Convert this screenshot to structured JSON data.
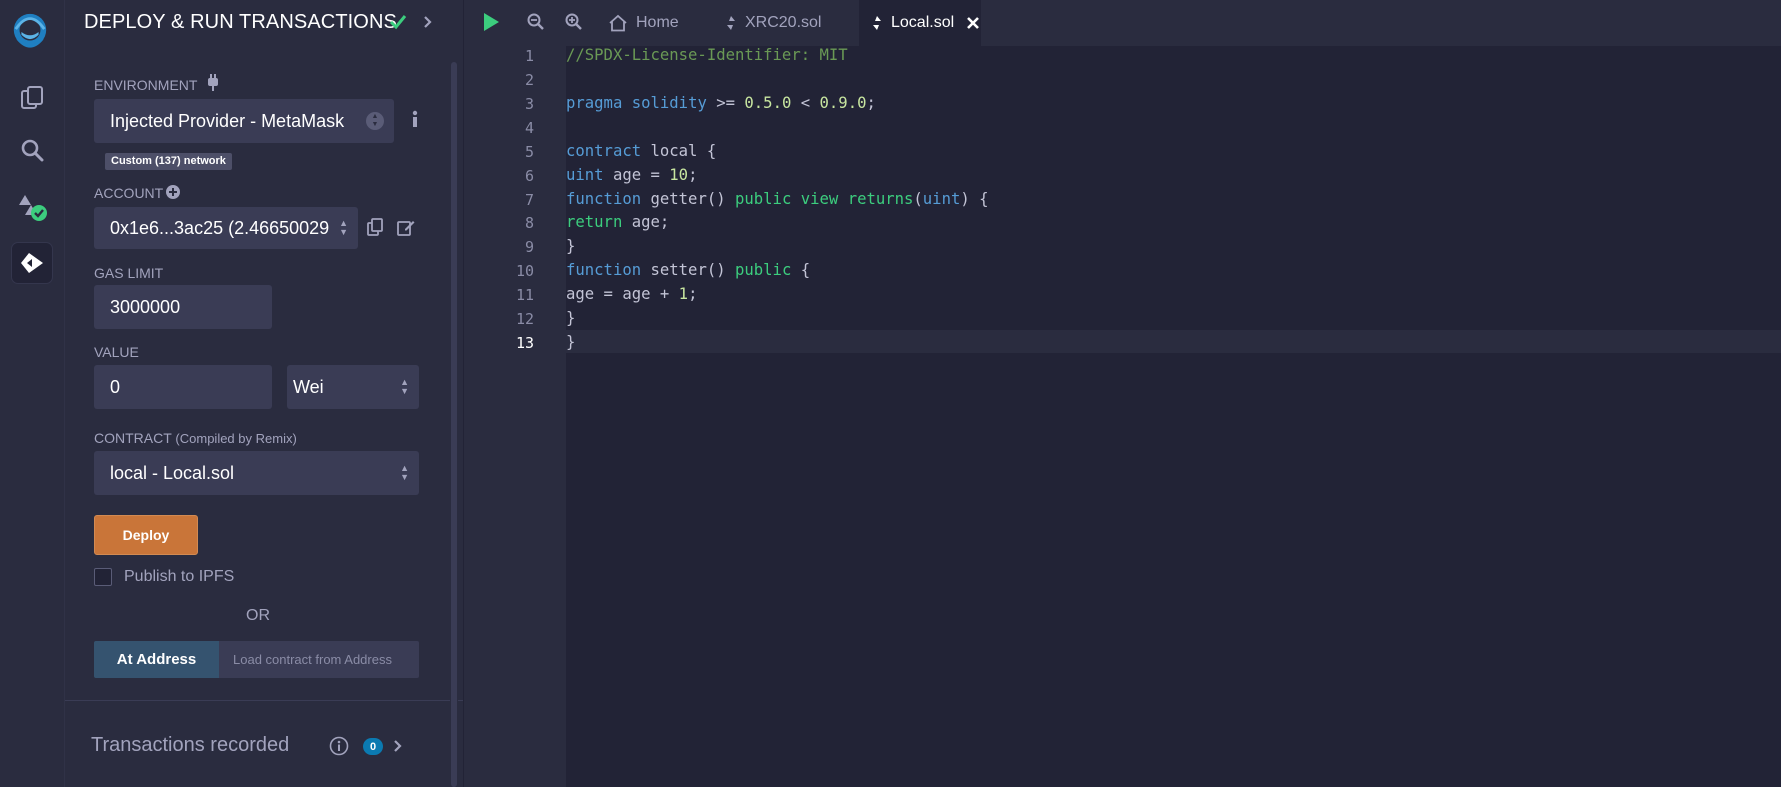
{
  "icon_rail": {
    "items": [
      {
        "name": "remix-logo-icon"
      },
      {
        "name": "file-explorer-icon"
      },
      {
        "name": "search-icon"
      },
      {
        "name": "solidity-compiler-icon"
      },
      {
        "name": "deploy-run-icon"
      }
    ]
  },
  "panel": {
    "title": "DEPLOY & RUN TRANSACTIONS",
    "environment": {
      "label": "ENVIRONMENT",
      "value": "Injected Provider - MetaMask",
      "network_badge": "Custom (137) network"
    },
    "account": {
      "label": "ACCOUNT",
      "value": "0x1e6...3ac25 (2.46650029"
    },
    "gas_limit": {
      "label": "GAS LIMIT",
      "value": "3000000"
    },
    "value": {
      "label": "VALUE",
      "amount": "0",
      "unit": "Wei"
    },
    "contract": {
      "label": "CONTRACT",
      "sublabel": "(Compiled by Remix)",
      "value": "local - Local.sol"
    },
    "deploy_label": "Deploy",
    "publish_label": "Publish to IPFS",
    "or_label": "OR",
    "at_address_label": "At Address",
    "at_address_placeholder": "Load contract from Address",
    "transactions": {
      "title": "Transactions recorded",
      "count": "0"
    }
  },
  "editor": {
    "tabs": [
      {
        "label": "Home"
      },
      {
        "label": "XRC20.sol"
      },
      {
        "label": "Local.sol",
        "active": true
      }
    ],
    "current_line": 13,
    "line_numbers": [
      "1",
      "2",
      "3",
      "4",
      "5",
      "6",
      "7",
      "8",
      "9",
      "10",
      "11",
      "12",
      "13"
    ],
    "code_lines": [
      "//SPDX-License-Identifier: MIT",
      "",
      "pragma solidity >= 0.5.0 < 0.9.0;",
      "",
      "contract local {",
      "uint age = 10;",
      "function getter() public view returns(uint) {",
      "return age;",
      "}",
      "function setter() public {",
      "age = age + 1;",
      "}",
      "}"
    ]
  },
  "colors": {
    "background": "#222336",
    "panel": "#2a2c3f",
    "input": "#3a3c55",
    "deploy_button": "#c97539",
    "at_address_button": "#35536f",
    "success_green": "#3ccd7e",
    "badge_blue": "#0b7ab1"
  }
}
